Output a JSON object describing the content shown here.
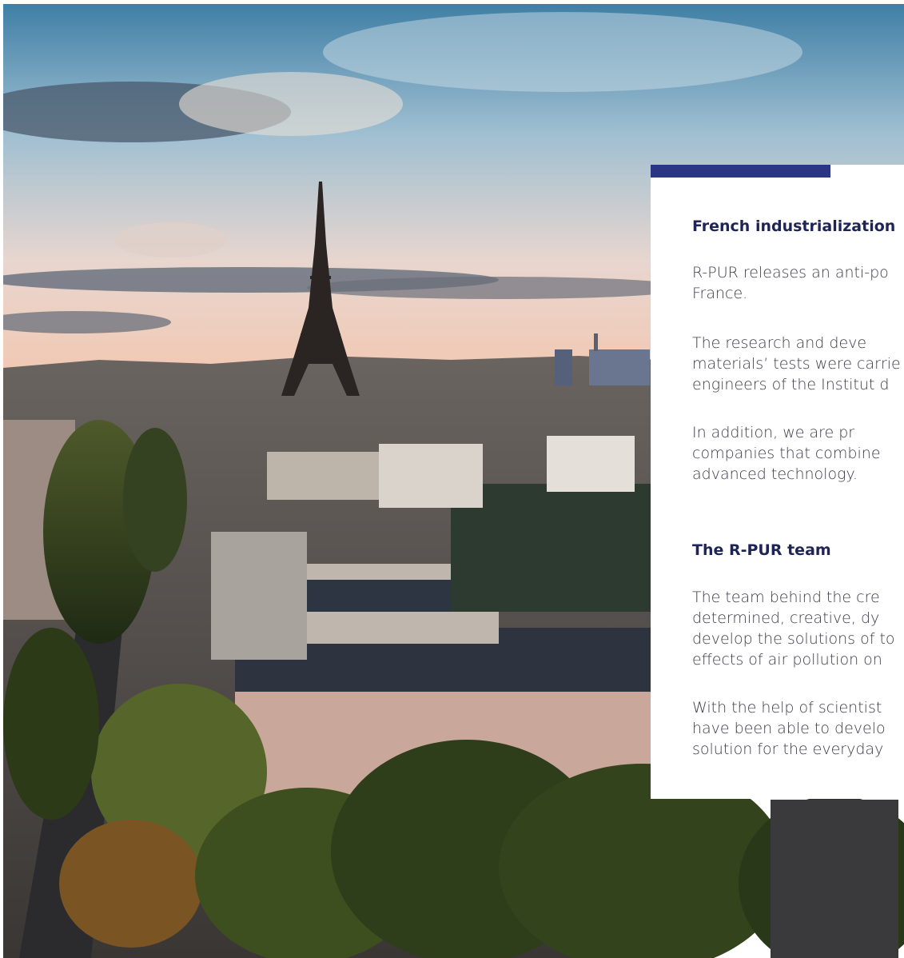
{
  "photo": {
    "alt_icon": "paris-eiffel-tower-photo"
  },
  "card": {
    "accent_color": "#2b3585",
    "sections": [
      {
        "title": "French industrialization",
        "paragraphs": [
          [
            "R-PUR releases an anti-po",
            "France."
          ],
          [
            "The  research  and  deve",
            "materials’ tests were carrie",
            "engineers of the Institut d"
          ],
          [
            "In  addition,  we  are  pr",
            "companies  that  combine",
            "advanced technology."
          ]
        ]
      },
      {
        "title": "The R-PUR team",
        "paragraphs": [
          [
            "The  team  behind  the  cre",
            "determined,  creative,  dy",
            "develop the solutions of to",
            "effects of air pollution on"
          ],
          [
            "With the help of scientist",
            "have been able to develo",
            "solution for the everyday"
          ]
        ]
      }
    ]
  }
}
